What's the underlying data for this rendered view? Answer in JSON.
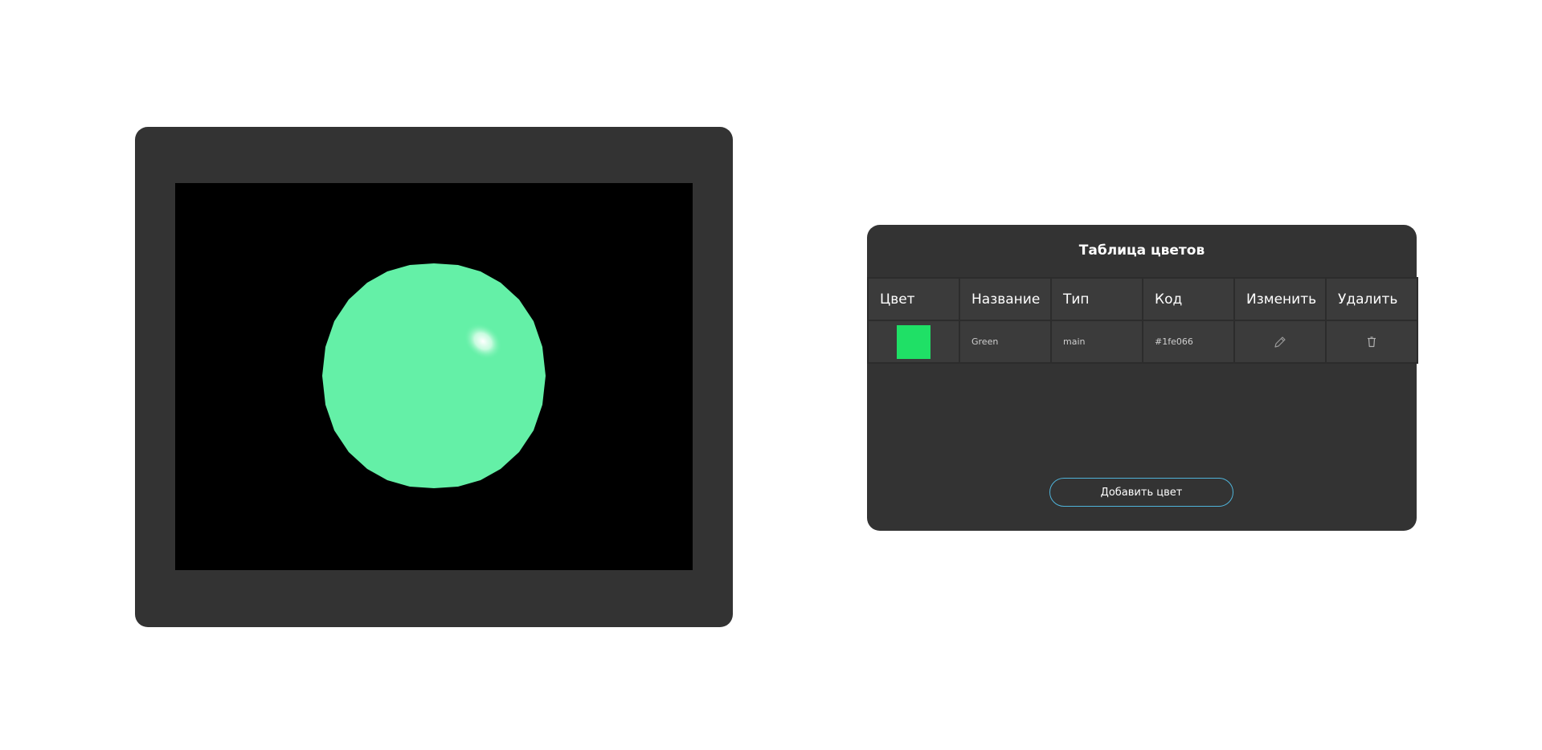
{
  "table": {
    "title": "Таблица цветов",
    "headers": [
      "Цвет",
      "Название",
      "Тип",
      "Код",
      "Изменить",
      "Удалить"
    ],
    "rows": [
      {
        "color": "#1fe066",
        "name": "Green",
        "type": "main",
        "code": "#1fe066",
        "edit_icon": "pencil-icon",
        "delete_icon": "trash-icon"
      }
    ],
    "add_button_label": "Добавить цвет"
  },
  "viewer": {
    "sphere_color": "#64f0a7",
    "background": "#000000"
  },
  "colors": {
    "panel": "#333333",
    "button_border": "#4fb3d9"
  }
}
